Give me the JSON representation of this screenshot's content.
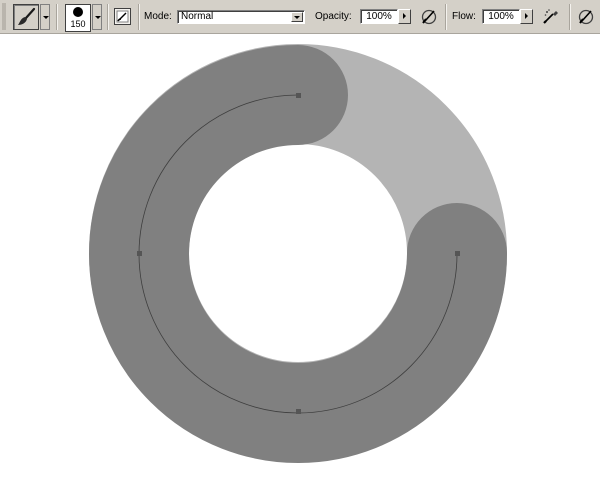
{
  "toolbar": {
    "brush_size": "150",
    "mode_label": "Mode:",
    "mode_value": "Normal",
    "opacity_label": "Opacity:",
    "opacity_value": "100%",
    "flow_label": "Flow:",
    "flow_value": "100%"
  },
  "canvas": {
    "ring_color": "#808080",
    "ring_light_color": "#b4b4b4",
    "path_color": "#3e3e3e",
    "anchor_color": "#555555"
  },
  "icons": {
    "tool": "brush-icon",
    "palette": "brush-palette-icon",
    "airbrush": "airbrush-icon"
  }
}
